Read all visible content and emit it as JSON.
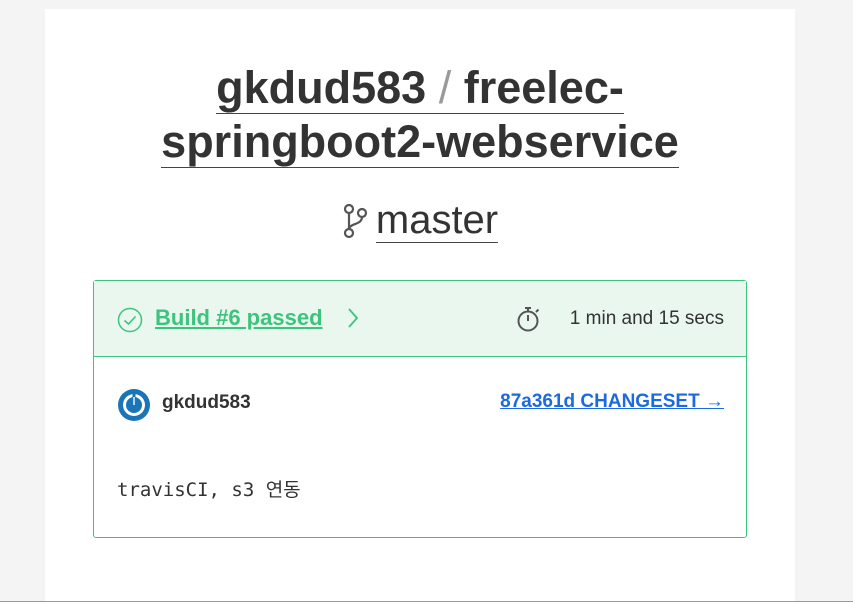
{
  "repo": {
    "owner": "gkdud583",
    "separator": "/",
    "name_part1": "freelec-",
    "name_part2": "springboot2-webservice"
  },
  "branch": {
    "name": "master",
    "icon": "git-branch-icon"
  },
  "build": {
    "label": "Build #6 passed",
    "status": "passed",
    "duration": "1 min and 15 secs",
    "status_color": "#3cc47c"
  },
  "commit": {
    "author": "gkdud583",
    "changeset_label": "87a361d CHANGESET →",
    "message": "travisCI, s3 연동"
  },
  "colors": {
    "link": "#1b6ae0",
    "passed": "#3cc47c",
    "passed_bg": "#e9f7ef"
  }
}
